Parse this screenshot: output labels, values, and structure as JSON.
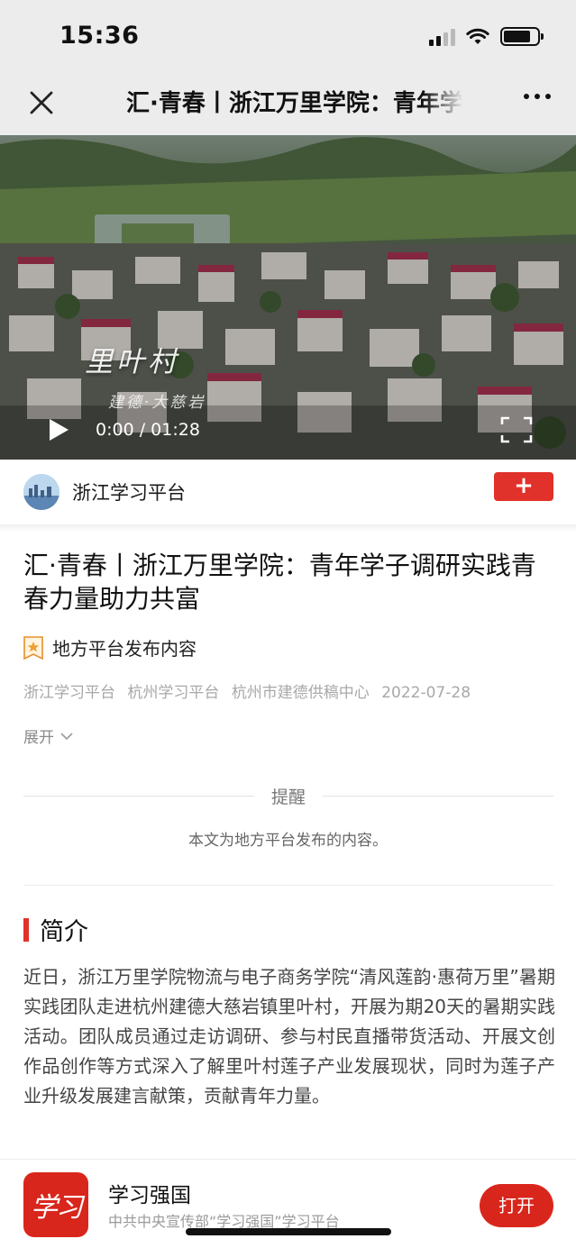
{
  "status_bar": {
    "time": "15:36",
    "signal_bars": 4,
    "signal_bars_filled": 2,
    "battery_level": 0.8
  },
  "nav": {
    "title": "汇·青春丨浙江万里学院：青年学子调研实践青春力量助力共富"
  },
  "video": {
    "overlay_title": "里叶村",
    "overlay_subtitle": "建德·大慈岩",
    "time_display": "0:00 / 01:28"
  },
  "author": {
    "name": "浙江学习平台",
    "follow_label": "+"
  },
  "article": {
    "title": "汇·青春丨浙江万里学院：青年学子调研实践青春力量助力共富",
    "source_tag": "地方平台发布内容",
    "meta": [
      "浙江学习平台",
      "杭州学习平台",
      "杭州市建德供稿中心",
      "2022-07-28"
    ],
    "expand_label": "展开"
  },
  "notice": {
    "heading": "提醒",
    "text": "本文为地方平台发布的内容。"
  },
  "section": {
    "title": "简介",
    "body": "近日，浙江万里学院物流与电子商务学院“清风莲韵·惠荷万里”暑期实践团队走进杭州建德大慈岩镇里叶村，开展为期20天的暑期实践活动。团队成员通过走访调研、参与村民直播带货活动、开展文创作品创作等方式深入了解里叶村莲子产业发展现状，同时为莲子产业升级发展建言献策，贡献青年力量。"
  },
  "banner": {
    "app_name": "学习强国",
    "subtitle": "中共中央宣传部“学习强国”学习平台",
    "logo_text": "学习",
    "open_label": "打开"
  },
  "colors": {
    "accent_red": "#e0312a",
    "nav_bg": "#ececec"
  }
}
